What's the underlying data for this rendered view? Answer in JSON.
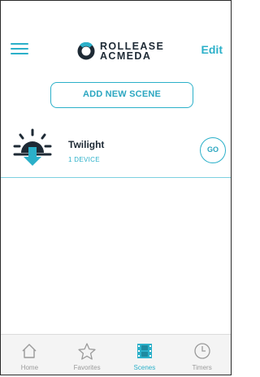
{
  "header": {
    "menu_icon": "hamburger-menu-icon",
    "logo_line1": "ROLLEASE",
    "logo_line2": "ACMEDA",
    "edit_label": "Edit"
  },
  "add_scene_label": "ADD NEW SCENE",
  "scenes": [
    {
      "name": "Twilight",
      "devices": "1 DEVICE",
      "icon": "sunset-icon",
      "go_label": "GO"
    }
  ],
  "tabs": [
    {
      "label": "Home",
      "icon": "home-icon",
      "active": false
    },
    {
      "label": "Favorites",
      "icon": "star-icon",
      "active": false
    },
    {
      "label": "Scenes",
      "icon": "film-icon",
      "active": true
    },
    {
      "label": "Timers",
      "icon": "clock-icon",
      "active": false
    }
  ],
  "colors": {
    "accent": "#2bb0c9",
    "text": "#1e2a35",
    "tab_inactive": "#9a9a9a",
    "tabbar_bg": "#f4f4f4"
  }
}
